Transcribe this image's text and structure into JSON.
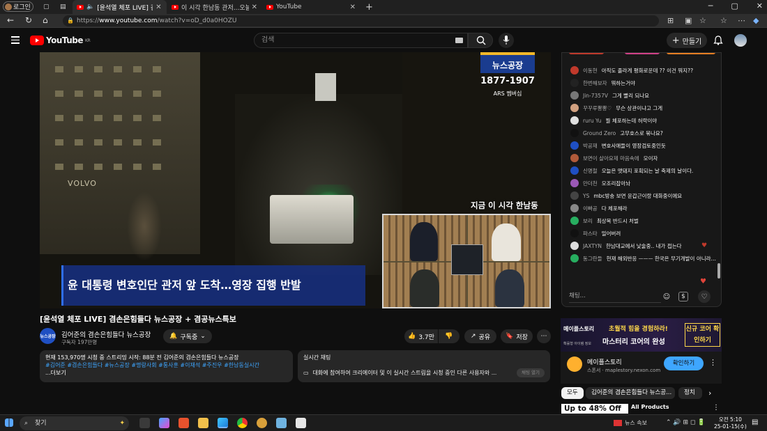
{
  "browser": {
    "profile_label": "로그인",
    "tabs": [
      {
        "title": "[윤석열 체포 LIVE] 겸손은힘"
      },
      {
        "title": "이 시각 한남동 관저...오늘 새벽 \"공"
      },
      {
        "title": "YouTube"
      }
    ],
    "url_prefix": "https://",
    "url_host": "www.youtube.com",
    "url_path": "/watch?v=oD_d0a0HOZU"
  },
  "youtube": {
    "logo_text": "YouTube",
    "logo_region": "KR",
    "search_placeholder": "검색",
    "create_label": "만들기"
  },
  "video": {
    "title": "[윤석열 체포 LIVE] 겸손은힘들다 뉴스공장 + 겸공뉴스특보",
    "overlay_logo": "뉴스공장",
    "overlay_phone": "1877-1907",
    "overlay_ars": "ARS 멤버십",
    "overlay_location": "지금 이 시각 한남동",
    "caption": "윤 대통령 변호인단 관저 앞 도착…영장 집행 반발",
    "bus_label": "VOLVO"
  },
  "channel": {
    "avatar_text": "뉴스공장",
    "name": "김어준의 겸손은힘들다 뉴스공장",
    "subs": "구독자 197만명",
    "subscribed_label": "구독중"
  },
  "actions": {
    "likes": "3.7만",
    "share": "공유",
    "save": "저장"
  },
  "description": {
    "meta": "현재 153,970명 시청 중 스트리밍 시작: 88분 전  김어준의 겸손은힘들다 뉴스공장",
    "tags": "#김어준 #겸손은힘들다 #뉴스공장 #명랑사회 #통사훈 #이재석 #주진우 #한남동실시간",
    "more": "...더보기"
  },
  "live_chat_box": {
    "title": "실시간 채팅",
    "text": "대화에 참여하여 크리에이터 및 이 실시간 스트림을 시청 중인 다른 사용자와 ...",
    "open_label": "채팅 열기"
  },
  "chat": {
    "messages": [
      {
        "author": "이동현",
        "text": "아직도 졸라게 평화로운데 ?? 이건 뭐지??",
        "color": "#c0392b"
      },
      {
        "author": "한번해보자",
        "text": "뭐하는거야",
        "color": "#222222"
      },
      {
        "author": "Jin-7357V",
        "text": "그게 빨리 되나요",
        "color": "#777777"
      },
      {
        "author": "꾸꾸루뽕뽕♡",
        "text": "무슨 상관이냐고 그게",
        "color": "#d0a080"
      },
      {
        "author": "ruru Yu",
        "text": "뭘 체포하는데 허락이야",
        "color": "#e0e0e0"
      },
      {
        "author": "Ground Zero",
        "text": "고무호스로 묶나요?",
        "color": "#111111"
      },
      {
        "author": "박공재",
        "text": "변호사애들이 영장검토중인듯",
        "color": "#1f4fc2"
      },
      {
        "author": "보면이 살아요제 마음속에",
        "text": "모이자",
        "color": "#b05a3a"
      },
      {
        "author": "신명철",
        "text": "오늘은 맷돼지 포획되는 날 축제의 날이다.",
        "color": "#1f4fc2"
      },
      {
        "author": "만더천",
        "text": "모조리잡아놔",
        "color": "#9b59b6"
      },
      {
        "author": "YS",
        "text": "mbc방송 보면 윤갑근이랑 대화중이에요",
        "color": "#444444"
      },
      {
        "author": "이빠공",
        "text": "다 체포해라",
        "color": "#888888"
      },
      {
        "author": "보리",
        "text": "최상목 반드시 처벌",
        "color": "#27ae60"
      },
      {
        "author": "파스타",
        "text": "밀어버려",
        "color": "#111111"
      },
      {
        "author": "JAXTYN",
        "text": "한남대교에서 낮술중.. 내가 접는다",
        "color": "#dddddd"
      },
      {
        "author": "동그란들",
        "text": "현재 해외반응 ㅡㅡㅡ 한국은 무기개발이 아니라 평화에 찌들어 싸우기를 겁내하는 나약한",
        "color": "#27ae60"
      }
    ],
    "input_placeholder": "채팅..."
  },
  "ad": {
    "banner_brand": "메이플스토리",
    "banner_sub": "확률형 아이템 정보",
    "banner_line1": "초월적 힘을 경험하라!",
    "banner_line2": "마스터리 코어의 완성",
    "banner_cta": "신규 코어 확인하기",
    "name": "메이플스토리",
    "sponsor": "스폰서 · maplestory.nexon.com",
    "install_label": "확인하기"
  },
  "chips": [
    "모두",
    "김어준의 겸손은힘들다 뉴스공...",
    "정치"
  ],
  "promo": {
    "discount": "Up to 48% Off",
    "products": "All Products"
  },
  "taskbar": {
    "search_label": "찾기",
    "news_label": "뉴스 속보",
    "time": "오전 5:10",
    "date": "25-01-15(수)"
  }
}
